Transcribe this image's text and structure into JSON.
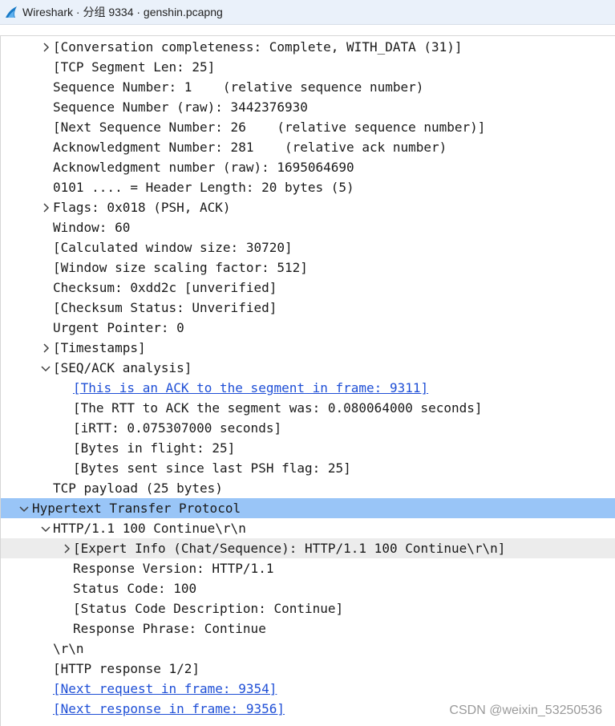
{
  "window": {
    "title": "Wireshark · 分组 9334 · genshin.pcapng",
    "icon": "wireshark-fin-icon"
  },
  "tree_rows": [
    {
      "text": "[Conversation completeness: Complete, WITH_DATA (31)]",
      "caret": "right",
      "link": false
    },
    {
      "text": "[TCP Segment Len: 25]",
      "caret": "",
      "link": false
    },
    {
      "text": "Sequence Number: 1    (relative sequence number)",
      "caret": "",
      "link": false
    },
    {
      "text": "Sequence Number (raw): 3442376930",
      "caret": "",
      "link": false
    },
    {
      "text": "[Next Sequence Number: 26    (relative sequence number)]",
      "caret": "",
      "link": false
    },
    {
      "text": "Acknowledgment Number: 281    (relative ack number)",
      "caret": "",
      "link": false
    },
    {
      "text": "Acknowledgment number (raw): 1695064690",
      "caret": "",
      "link": false
    },
    {
      "text": "0101 .... = Header Length: 20 bytes (5)",
      "caret": "",
      "link": false
    },
    {
      "text": "Flags: 0x018 (PSH, ACK)",
      "caret": "right",
      "link": false
    },
    {
      "text": "Window: 60",
      "caret": "",
      "link": false
    },
    {
      "text": "[Calculated window size: 30720]",
      "caret": "",
      "link": false
    },
    {
      "text": "[Window size scaling factor: 512]",
      "caret": "",
      "link": false
    },
    {
      "text": "Checksum: 0xdd2c [unverified]",
      "caret": "",
      "link": false
    },
    {
      "text": "[Checksum Status: Unverified]",
      "caret": "",
      "link": false
    },
    {
      "text": "Urgent Pointer: 0",
      "caret": "",
      "link": false
    },
    {
      "text": "[Timestamps]",
      "caret": "right",
      "link": false
    },
    {
      "text": "[SEQ/ACK analysis]",
      "caret": "down",
      "link": false
    },
    {
      "text": "[This is an ACK to the segment in frame: 9311]",
      "caret": "",
      "link": true
    },
    {
      "text": "[The RTT to ACK the segment was: 0.080064000 seconds]",
      "caret": "",
      "link": false
    },
    {
      "text": "[iRTT: 0.075307000 seconds]",
      "caret": "",
      "link": false
    },
    {
      "text": "[Bytes in flight: 25]",
      "caret": "",
      "link": false
    },
    {
      "text": "[Bytes sent since last PSH flag: 25]",
      "caret": "",
      "link": false
    },
    {
      "text": "TCP payload (25 bytes)",
      "caret": "",
      "link": false
    },
    {
      "text": "Hypertext Transfer Protocol",
      "caret": "down",
      "link": false,
      "highlight": "selected"
    },
    {
      "text": "HTTP/1.1 100 Continue\\r\\n",
      "caret": "down",
      "link": false
    },
    {
      "text": "[Expert Info (Chat/Sequence): HTTP/1.1 100 Continue\\r\\n]",
      "caret": "right",
      "link": false,
      "highlight": "hover"
    },
    {
      "text": "Response Version: HTTP/1.1",
      "caret": "",
      "link": false
    },
    {
      "text": "Status Code: 100",
      "caret": "",
      "link": false
    },
    {
      "text": "[Status Code Description: Continue]",
      "caret": "",
      "link": false
    },
    {
      "text": "Response Phrase: Continue",
      "caret": "",
      "link": false
    },
    {
      "text": "\\r\\n",
      "caret": "",
      "link": false
    },
    {
      "text": "[HTTP response 1/2]",
      "caret": "",
      "link": false
    },
    {
      "text": "[Next request in frame: 9354]",
      "caret": "",
      "link": true
    },
    {
      "text": "[Next response in frame: 9356]",
      "caret": "",
      "link": true
    }
  ],
  "watermark": "CSDN @weixin_53250536",
  "colors": {
    "selected_row": "#99c5f7",
    "hover_row": "#ececec",
    "link": "#1f4fd6"
  }
}
